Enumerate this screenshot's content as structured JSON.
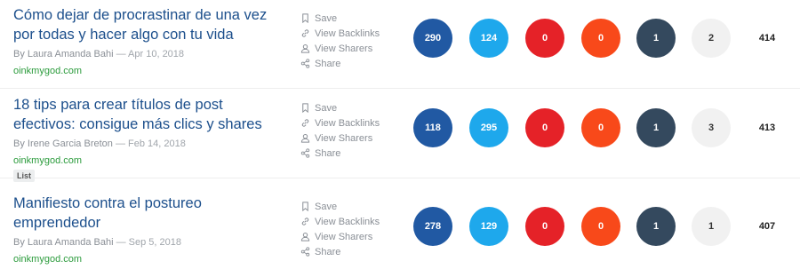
{
  "articles": [
    {
      "title": "Cómo dejar de procrastinar de una vez por todas y hacer algo con tu vida",
      "byline": "By Laura Amanda Bahi",
      "date": "— Apr 10, 2018",
      "domain": "oinkmygod.com",
      "tag": "",
      "actions": [
        "Save",
        "View Backlinks",
        "View Sharers",
        "Share"
      ],
      "metrics": [
        "290",
        "124",
        "0",
        "0",
        "1",
        "2"
      ],
      "total": "414"
    },
    {
      "title": "18 tips para crear títulos de post efectivos: consigue más clics y shares",
      "byline": "By Irene Garcia Breton",
      "date": "— Feb 14, 2018",
      "domain": "oinkmygod.com",
      "tag": "List",
      "actions": [
        "Save",
        "View Backlinks",
        "View Sharers",
        "Share"
      ],
      "metrics": [
        "118",
        "295",
        "0",
        "0",
        "1",
        "3"
      ],
      "total": "413"
    },
    {
      "title": "Manifiesto contra el postureo emprendedor",
      "byline": "By Laura Amanda Bahi",
      "date": "— Sep 5, 2018",
      "domain": "oinkmygod.com",
      "tag": "",
      "actions": [
        "Save",
        "View Backlinks",
        "View Sharers",
        "Share"
      ],
      "metrics": [
        "278",
        "129",
        "0",
        "0",
        "1",
        "1"
      ],
      "total": "407"
    }
  ],
  "metric_colors": [
    "#2159a3",
    "#1ea8ec",
    "#e52228",
    "#f8491a",
    "#34495e",
    "#f1f1f1"
  ],
  "metric_names": [
    "facebook",
    "twitter",
    "pinterest",
    "reddit",
    "linkedin",
    "other"
  ],
  "action_icons": [
    "bookmark-icon",
    "link-icon",
    "user-icon",
    "share-icon"
  ]
}
